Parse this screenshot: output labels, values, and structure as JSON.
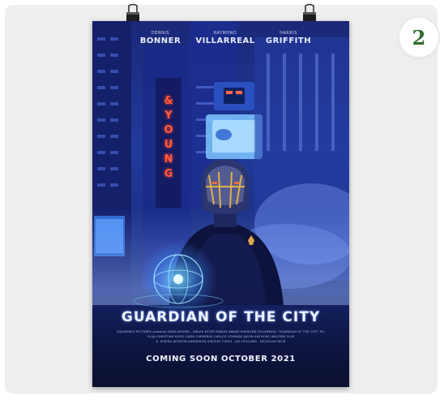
{
  "badge": {
    "number": "2"
  },
  "poster": {
    "cast": [
      {
        "first": "DENNIS",
        "last": "BONNER"
      },
      {
        "first": "RAYMOND",
        "last": "VILLARREAL"
      },
      {
        "first": "HARRIS",
        "last": "GRIFFITH"
      }
    ],
    "neon_sign": [
      "&",
      "Y",
      "O",
      "U",
      "N",
      "G"
    ],
    "title": "GUARDIAN OF THE CITY",
    "credits": [
      "SQUIREBOY PICTURES presents DANA MOORE . ARAGE ESTER RANUM AWAKE RAYMOND VILLARREAL \"GUARDIAN OF THE CITY\" FILM BY ARCANGEL",
      "ELIJA CHRISTIAN MOSS LINDA CARRERAS CARLOS COMINSK JASON ANTHONY WALTERS FILM",
      "K. RIVERA JACKSON ANDERSON VINCENT FINCH . JAE HOLLAND . NICHOLAS NOIR"
    ],
    "release": "COMING SOON OCTOBER 2021"
  },
  "colors": {
    "badge_text": "#2f6b2f",
    "poster_blue": "#213a9a",
    "neon": "#ff5b3a"
  }
}
